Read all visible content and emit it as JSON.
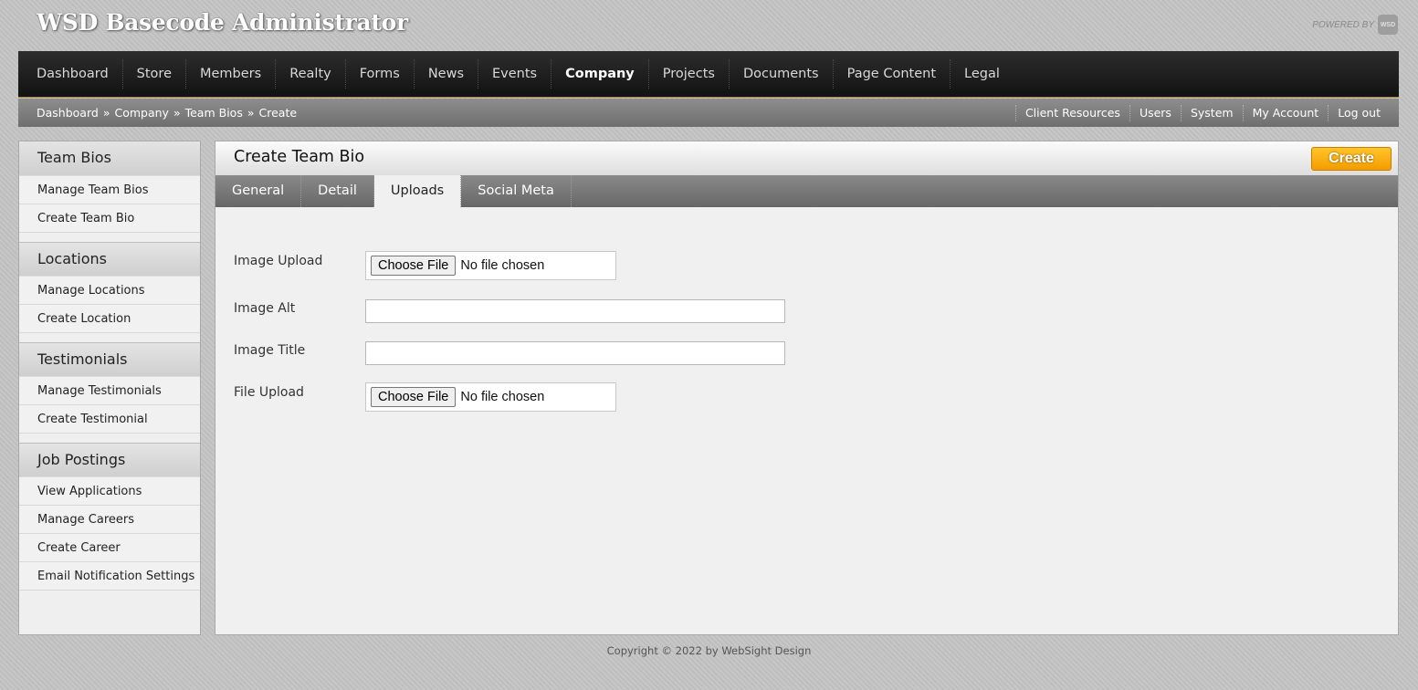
{
  "header": {
    "app_title": "WSD Basecode Administrator",
    "powered_by": "POWERED BY",
    "logo_text": "WSD"
  },
  "main_nav": [
    {
      "label": "Dashboard",
      "active": false
    },
    {
      "label": "Store",
      "active": false
    },
    {
      "label": "Members",
      "active": false
    },
    {
      "label": "Realty",
      "active": false
    },
    {
      "label": "Forms",
      "active": false
    },
    {
      "label": "News",
      "active": false
    },
    {
      "label": "Events",
      "active": false
    },
    {
      "label": "Company",
      "active": true
    },
    {
      "label": "Projects",
      "active": false
    },
    {
      "label": "Documents",
      "active": false
    },
    {
      "label": "Page Content",
      "active": false
    },
    {
      "label": "Legal",
      "active": false
    }
  ],
  "breadcrumb": [
    "Dashboard",
    "Company",
    "Team Bios",
    "Create"
  ],
  "breadcrumb_sep": "»",
  "util_links": [
    "Client Resources",
    "Users",
    "System",
    "My Account",
    "Log out"
  ],
  "sidebar": [
    {
      "title": "Team Bios",
      "items": [
        "Manage Team Bios",
        "Create Team Bio"
      ]
    },
    {
      "title": "Locations",
      "items": [
        "Manage Locations",
        "Create Location"
      ]
    },
    {
      "title": "Testimonials",
      "items": [
        "Manage Testimonials",
        "Create Testimonial"
      ]
    },
    {
      "title": "Job Postings",
      "items": [
        "View Applications",
        "Manage Careers",
        "Create Career",
        "Email Notification Settings"
      ]
    }
  ],
  "content": {
    "title": "Create Team Bio",
    "create_label": "Create",
    "tabs": [
      {
        "label": "General",
        "active": false
      },
      {
        "label": "Detail",
        "active": false
      },
      {
        "label": "Uploads",
        "active": true
      },
      {
        "label": "Social Meta",
        "active": false
      }
    ],
    "form": {
      "image_upload_label": "Image Upload",
      "image_alt_label": "Image Alt",
      "image_title_label": "Image Title",
      "file_upload_label": "File Upload",
      "choose_file_label": "Choose File",
      "no_file_text": "No file chosen",
      "image_alt_value": "",
      "image_title_value": ""
    }
  },
  "footer": "Copyright © 2022 by WebSight Design"
}
